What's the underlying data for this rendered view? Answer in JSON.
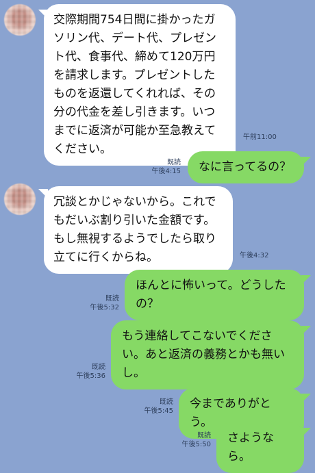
{
  "messages": [
    {
      "dir": "in",
      "text": "交際期間754日間に掛かったガソリン代、デート代、プレゼント代、食事代、締めて120万円を請求します。プレゼントしたものを返還してくれれば、その分の代金を差し引きます。いつまでに返済が可能か至急教えてください。",
      "time": "午前11:00"
    },
    {
      "dir": "out",
      "text": "なに言ってるの？",
      "read": "既読",
      "time": "午後4:15"
    },
    {
      "dir": "in",
      "text": "冗談とかじゃないから。これでもだいぶ割り引いた金額です。もし無視するようでしたら取り立てに行くからね。",
      "time": "午後4:32"
    },
    {
      "dir": "out",
      "text": "ほんとに怖いって。どうしたの？",
      "read": "既読",
      "time": "午後5:32"
    },
    {
      "dir": "out",
      "text": "もう連絡してこないでください。あと返済の義務とかも無いし。",
      "read": "既読",
      "time": "午後5:36"
    },
    {
      "dir": "out",
      "text": "今までありがとう。",
      "read": "既読",
      "time": "午後5:45"
    },
    {
      "dir": "out",
      "text": "さようなら。",
      "read": "既読",
      "time": "午後5:50"
    }
  ],
  "colors": {
    "background": "#8aa3d0",
    "incoming": "#ffffff",
    "outgoing": "#86d965"
  },
  "icons": {
    "avatar": "blurred-profile-photo"
  }
}
